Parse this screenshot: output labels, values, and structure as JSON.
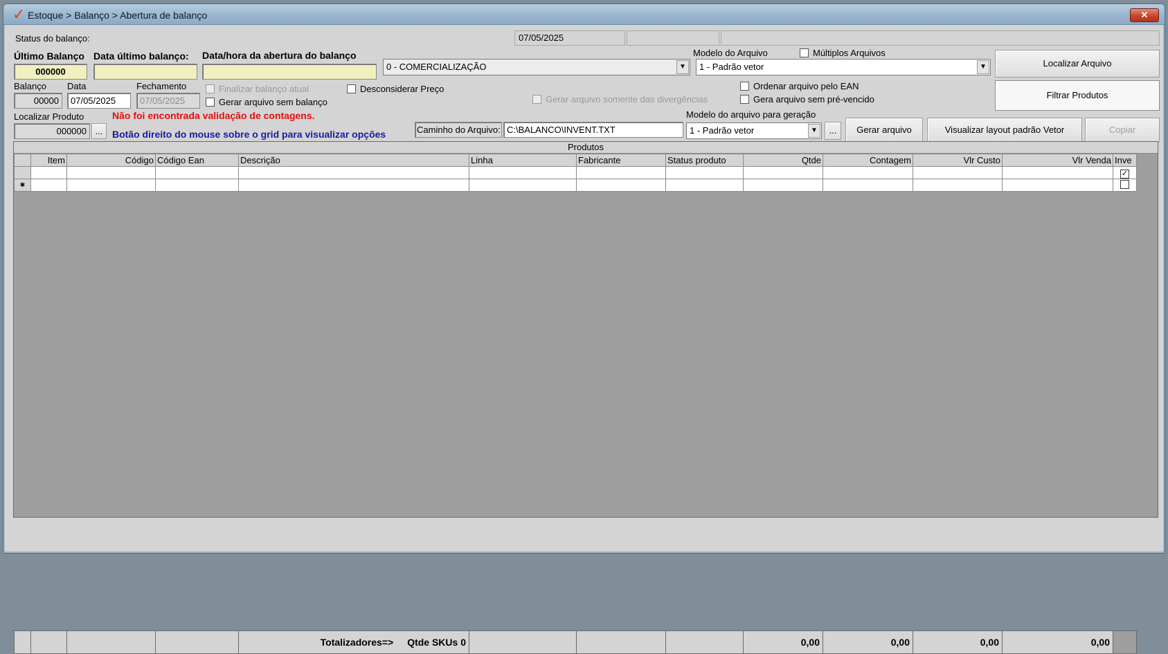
{
  "window": {
    "title": "Estoque > Balanço > Abertura de balanço",
    "close_label": "✕"
  },
  "status": {
    "label": "Status do balanço:",
    "date": "07/05/2025",
    "field2": "",
    "field3": ""
  },
  "ultimo": {
    "ultimo_label": "Último Balanço",
    "ultimo_value": "000000",
    "data_label": "Data último balanço:",
    "data_value": "",
    "abertura_label": "Data/hora da abertura do balanço",
    "abertura_value": ""
  },
  "comercializacao": {
    "value": "0 - COMERCIALIZAÇÃO"
  },
  "modelo": {
    "label": "Modelo do Arquivo",
    "value": "1 - Padrão vetor",
    "multiplos_label": "Múltiplos Arquivos",
    "multiplos_checked": false
  },
  "buttons": {
    "localizar_arquivo": "Localizar Arquivo",
    "filtrar_produtos": "Filtrar Produtos",
    "gerar_arquivo": "Gerar arquivo",
    "visualizar_layout": "Visualizar layout padrão Vetor",
    "copiar": "Copiar",
    "ellipsis": "..."
  },
  "balanco": {
    "balanco_label": "Balanço",
    "balanco_value": "00000",
    "data_label": "Data",
    "data_value": "07/05/2025",
    "fechamento_label": "Fechamento",
    "fechamento_value": "07/05/2025"
  },
  "options": {
    "finalizar": "Finalizar balanço atual",
    "gerar_sem_balanco": "Gerar arquivo sem balanço",
    "desconsiderar_preco": "Desconsiderar Preço",
    "gerar_divergencias": "Gerar arquivo somente das divergências",
    "ordenar_ean": "Ordenar arquivo pelo EAN",
    "gera_sem_prevencido": "Gera arquivo sem pré-vencido"
  },
  "localizar": {
    "label": "Localizar Produto",
    "value": "000000"
  },
  "messages": {
    "nao_encontrada": "Não foi encontrada validação de contagens.",
    "botao_direito": "Botão direito do mouse sobre o grid para visualizar opções"
  },
  "caminho": {
    "label": "Caminho do Arquivo:",
    "value": "C:\\BALANCO\\INVENT.TXT"
  },
  "geracao": {
    "label": "Modelo do arquivo para geração",
    "value": "1 - Padrão vetor"
  },
  "grid": {
    "caption": "Produtos",
    "columns": [
      "Item",
      "Código",
      "Código Ean",
      "Descrição",
      "Linha",
      "Fabricante",
      "Status produto",
      "Qtde",
      "Contagem",
      "Vlr Custo",
      "Vlr Venda",
      "Inve"
    ],
    "rows": [
      {
        "indicator": "",
        "inve_checked": true
      },
      {
        "indicator": "✱",
        "inve_checked": false
      }
    ],
    "totals": {
      "label": "Totalizadores=>",
      "skus": "Qtde SKUs 0",
      "qtde": "0,00",
      "contagem": "0,00",
      "custo": "0,00",
      "venda": "0,00"
    }
  }
}
